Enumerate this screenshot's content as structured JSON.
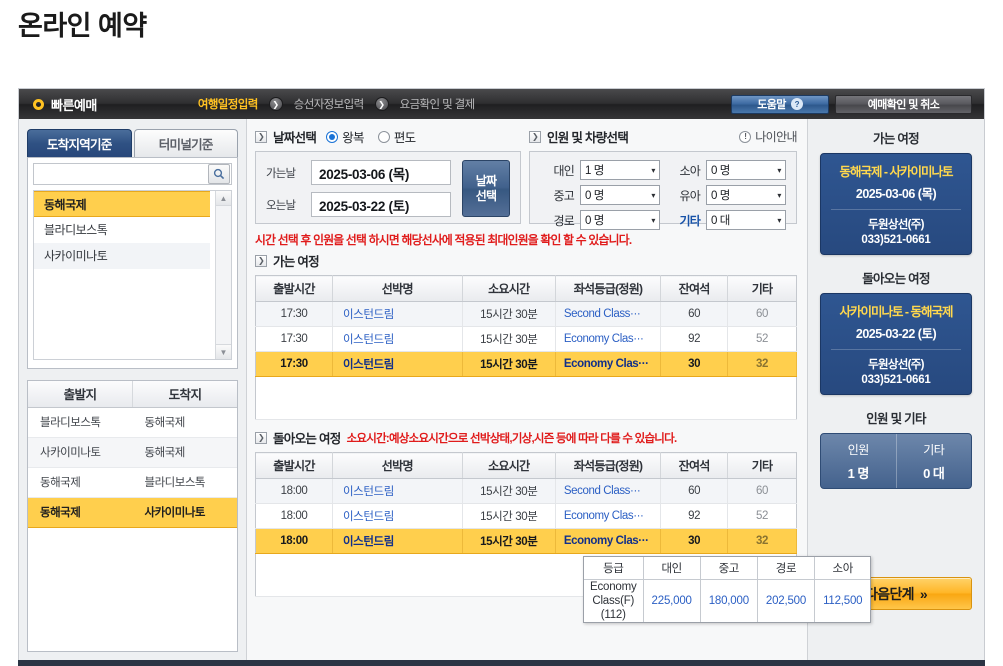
{
  "page": {
    "title": "온라인 예약"
  },
  "topnav": {
    "brand": "빠른예매",
    "steps": [
      {
        "label": "여행일정입력",
        "active": true
      },
      {
        "label": "승선자정보입력",
        "active": false
      },
      {
        "label": "요금확인 및 결제",
        "active": false
      }
    ],
    "arrow_glyph": "❯",
    "help_button": "도움말",
    "help_icon_glyph": "?",
    "cancel_button": "예매확인 및 취소"
  },
  "left": {
    "tabs": [
      {
        "label": "도착지역기준",
        "active": true
      },
      {
        "label": "터미널기준",
        "active": false
      }
    ],
    "search": {
      "value": "",
      "placeholder": "",
      "icon": "search-icon"
    },
    "regions": [
      {
        "label": "동해국제",
        "selected": true
      },
      {
        "label": "블라디보스톡",
        "selected": false
      },
      {
        "label": "사카이미나토",
        "selected": false
      }
    ],
    "route_table": {
      "headers": [
        "출발지",
        "도착지"
      ],
      "rows": [
        {
          "from": "블라디보스톡",
          "to": "동해국제",
          "selected": false
        },
        {
          "from": "사카이미나토",
          "to": "동해국제",
          "selected": false
        },
        {
          "from": "동해국제",
          "to": "블라디보스톡",
          "selected": false
        },
        {
          "from": "동해국제",
          "to": "사카이미나토",
          "selected": true
        }
      ]
    },
    "scrollbar": {
      "up": "▲",
      "down": "▼"
    }
  },
  "center": {
    "date_section": {
      "title": "날짜선택",
      "trip_types": [
        {
          "label": "왕복",
          "selected": true
        },
        {
          "label": "편도",
          "selected": false
        }
      ],
      "depart_label": "가는날",
      "depart_value": "2025-03-06 (목)",
      "return_label": "오는날",
      "return_value": "2025-03-22 (토)",
      "date_button_line1": "날짜",
      "date_button_line2": "선택"
    },
    "pax_section": {
      "title": "인원 및 차량선택",
      "age_info": "나이안내",
      "fields": [
        {
          "label": "대인",
          "value": "1 명",
          "highlight": false
        },
        {
          "label": "소아",
          "value": "0 명",
          "highlight": false
        },
        {
          "label": "중고",
          "value": "0 명",
          "highlight": false
        },
        {
          "label": "유아",
          "value": "0 명",
          "highlight": false
        },
        {
          "label": "경로",
          "value": "0 명",
          "highlight": false
        },
        {
          "label": "기타",
          "value": "0 대",
          "highlight": true
        }
      ]
    },
    "warning": "시간 선택 후 인원을 선택 하시면 해당선사에 적용된 최대인원을 확인 할 수 있습니다.",
    "outbound": {
      "title": "가는 여정",
      "headers": [
        "출발시간",
        "선박명",
        "소요시간",
        "좌석등급(정원)",
        "잔여석",
        "기타"
      ],
      "rows": [
        {
          "time": "17:30",
          "ship": "이스턴드림",
          "duration": "15시간 30분",
          "grade": "Second Class···",
          "seats": "60",
          "etc": "60",
          "selected": false
        },
        {
          "time": "17:30",
          "ship": "이스턴드림",
          "duration": "15시간 30분",
          "grade": "Economy Clas···",
          "seats": "92",
          "etc": "52",
          "selected": false
        },
        {
          "time": "17:30",
          "ship": "이스턴드림",
          "duration": "15시간 30분",
          "grade": "Economy Clas···",
          "seats": "30",
          "etc": "32",
          "selected": true
        }
      ]
    },
    "inbound": {
      "title": "돌아오는 여정",
      "subtitle": "소요시간:예상소요시간으로 선박상태,기상,시즌 등에 따라 다를 수 있습니다.",
      "headers": [
        "출발시간",
        "선박명",
        "소요시간",
        "좌석등급(정원)",
        "잔여석",
        "기타"
      ],
      "rows": [
        {
          "time": "18:00",
          "ship": "이스턴드림",
          "duration": "15시간 30분",
          "grade": "Second Class···",
          "seats": "60",
          "etc": "60",
          "selected": false
        },
        {
          "time": "18:00",
          "ship": "이스턴드림",
          "duration": "15시간 30분",
          "grade": "Economy Clas···",
          "seats": "92",
          "etc": "52",
          "selected": false
        },
        {
          "time": "18:00",
          "ship": "이스턴드림",
          "duration": "15시간 30분",
          "grade": "Economy Clas···",
          "seats": "30",
          "etc": "32",
          "selected": true
        }
      ]
    },
    "price_tooltip": {
      "headers": [
        "등급",
        "대인",
        "중고",
        "경로",
        "소아"
      ],
      "grade_line1": "Economy Class(F)",
      "grade_line2": "(112)",
      "prices": [
        "225,000",
        "180,000",
        "202,500",
        "112,500"
      ]
    }
  },
  "right": {
    "outbound_title": "가는 여정",
    "outbound_card": {
      "route": "동해국제 - 사카이미나토",
      "date": "2025-03-06 (목)",
      "company": "두원상선(주)",
      "tel": "033)521-0661"
    },
    "inbound_title": "돌아오는 여정",
    "inbound_card": {
      "route": "사카이미나토 - 동해국제",
      "date": "2025-03-22 (토)",
      "company": "두원상선(주)",
      "tel": "033)521-0661"
    },
    "pax_title": "인원 및 기타",
    "pax_summary": [
      {
        "key": "인원",
        "value": "1 명"
      },
      {
        "key": "기타",
        "value": "0 대"
      }
    ],
    "next_button": "다음단계",
    "next_button_glyph": "»"
  },
  "colors": {
    "accent_yellow": "#ffcf4d",
    "brand_blue": "#2f5691",
    "warning_red": "#e01b1b",
    "link_blue": "#2b5fc4"
  }
}
